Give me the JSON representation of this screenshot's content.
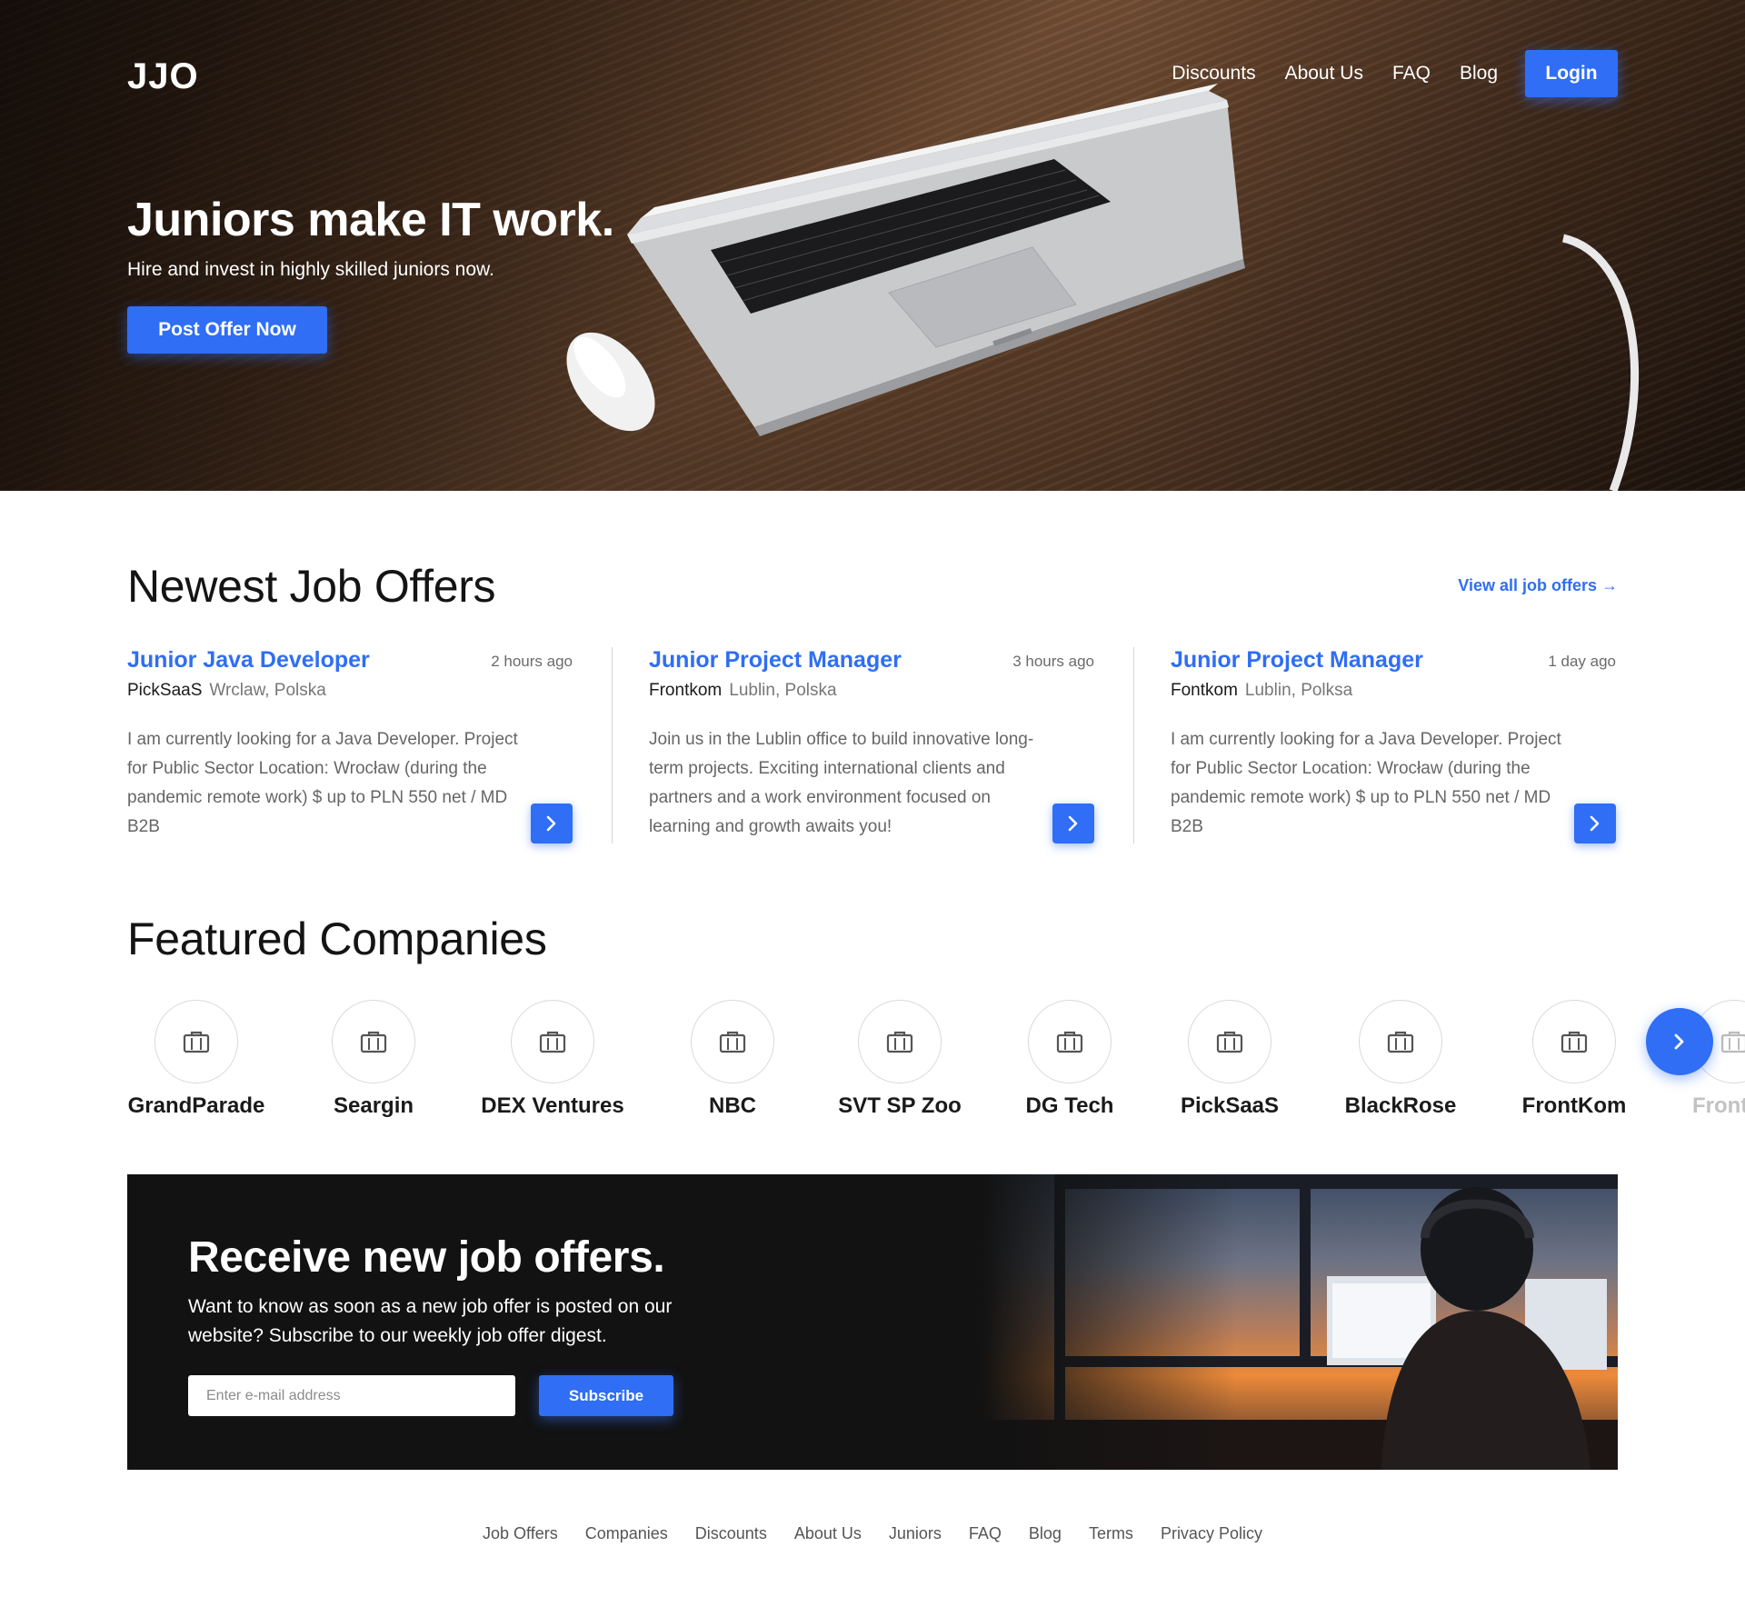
{
  "header": {
    "logo": "JJO",
    "nav": [
      {
        "label": "Discounts"
      },
      {
        "label": "About Us"
      },
      {
        "label": "FAQ"
      },
      {
        "label": "Blog"
      }
    ],
    "login_label": "Login"
  },
  "hero": {
    "title": "Juniors make IT work.",
    "subtitle": "Hire and invest in highly skilled juniors now.",
    "cta_label": "Post Offer Now"
  },
  "jobs": {
    "title": "Newest Job Offers",
    "view_all_label": "View all job offers →",
    "items": [
      {
        "title": "Junior Java Developer",
        "time": "2 hours ago",
        "company": "PickSaaS",
        "location": "Wrclaw, Polska",
        "description": "I am currently looking for a Java Developer. Project for Public Sector Location: Wrocław (during the pandemic remote work) $ up to PLN 550 net / MD B2B"
      },
      {
        "title": "Junior Project Manager",
        "time": "3 hours ago",
        "company": "Frontkom",
        "location": "Lublin, Polska",
        "description": "Join us in the Lublin office to build innovative long-term projects. Exciting international clients and partners and a work environment focused on learning and growth awaits you!"
      },
      {
        "title": "Junior Project Manager",
        "time": "1 day ago",
        "company": "Fontkom",
        "location": "Lublin, Polksa",
        "description": "I am currently looking for a Java Developer. Project for Public Sector Location: Wrocław (during the pandemic remote work) $ up to PLN 550 net / MD B2B"
      }
    ]
  },
  "companies": {
    "title": "Featured Companies",
    "items": [
      {
        "name": "GrandParade"
      },
      {
        "name": "Seargin"
      },
      {
        "name": "DEX Ventures"
      },
      {
        "name": "NBC"
      },
      {
        "name": "SVT SP Zoo"
      },
      {
        "name": "DG Tech"
      },
      {
        "name": "PickSaaS"
      },
      {
        "name": "BlackRose"
      },
      {
        "name": "FrontKom"
      },
      {
        "name": "Front"
      }
    ]
  },
  "newsletter": {
    "title": "Receive new job offers.",
    "text": "Want to know as soon as a new job offer is posted on our website? Subscribe to our weekly job offer digest.",
    "input_placeholder": "Enter e-mail address",
    "subscribe_label": "Subscribe"
  },
  "footer": {
    "links": [
      {
        "label": "Job Offers"
      },
      {
        "label": "Companies"
      },
      {
        "label": "Discounts"
      },
      {
        "label": "About Us"
      },
      {
        "label": "Juniors"
      },
      {
        "label": "FAQ"
      },
      {
        "label": "Blog"
      },
      {
        "label": "Terms"
      },
      {
        "label": "Privacy Policy"
      }
    ]
  },
  "theme": {
    "accent": "#2f6ef5",
    "dark": "#121212"
  },
  "icons": {
    "job_arrow": "chevron-right-icon",
    "company_logo": "briefcase-icon",
    "carousel_next": "chevron-right-icon"
  }
}
